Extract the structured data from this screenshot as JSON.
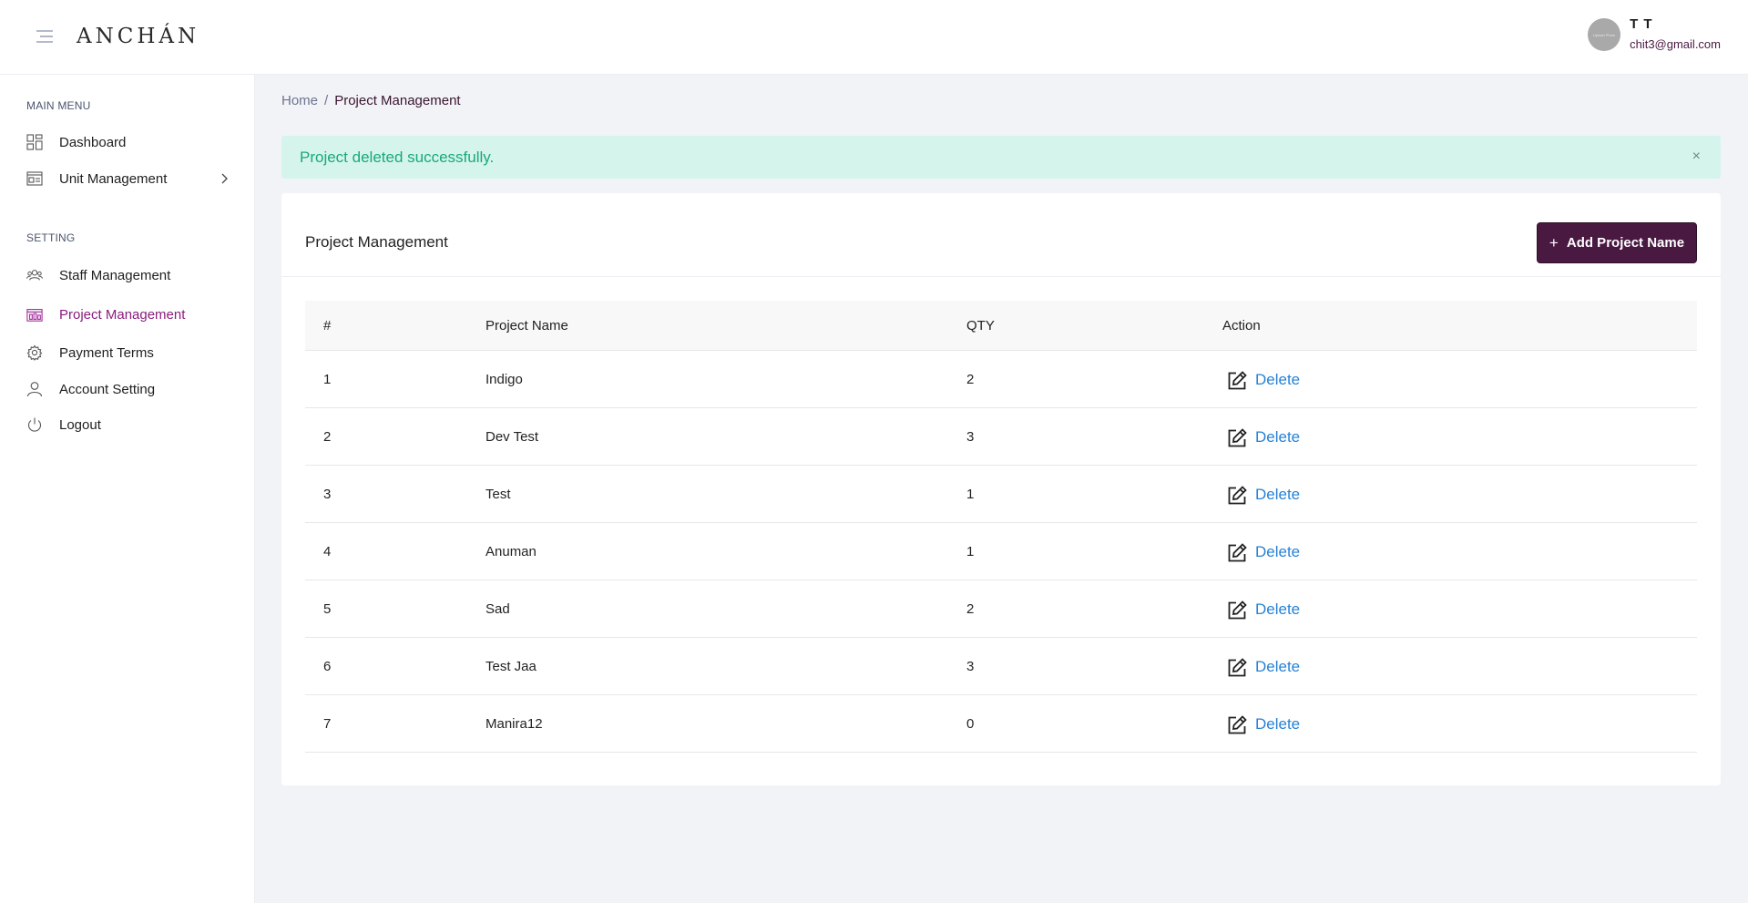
{
  "header": {
    "logo": "ANCHÁN",
    "user": {
      "avatar_text": "Upload Photo",
      "name": "T T",
      "email": "chit3@gmail.com"
    }
  },
  "sidebar": {
    "main_menu_title": "MAIN MENU",
    "main_items": [
      {
        "label": "Dashboard",
        "icon": "dashboard-icon"
      },
      {
        "label": "Unit Management",
        "icon": "unit-icon"
      }
    ],
    "setting_title": "SETTING",
    "setting_items": [
      {
        "label": "Staff Management",
        "icon": "users-icon"
      },
      {
        "label": "Project Management",
        "icon": "project-icon",
        "active": true
      },
      {
        "label": "Payment Terms",
        "icon": "gear-icon"
      },
      {
        "label": "Account Setting",
        "icon": "user-icon"
      },
      {
        "label": "Logout",
        "icon": "power-icon"
      }
    ],
    "active_color": "#8a1d7c"
  },
  "breadcrumb": {
    "home": "Home",
    "separator": "/",
    "current": "Project Management"
  },
  "alert": {
    "message": "Project deleted successfully.",
    "close": "×"
  },
  "card": {
    "title": "Project Management",
    "add_button": "Add Project Name",
    "add_icon": "+"
  },
  "table": {
    "columns": [
      "#",
      "Project Name",
      "QTY",
      "Action"
    ],
    "rows": [
      {
        "no": "1",
        "name": "Indigo",
        "qty": "2",
        "action": "Delete"
      },
      {
        "no": "2",
        "name": "Dev Test",
        "qty": "3",
        "action": "Delete"
      },
      {
        "no": "3",
        "name": "Test",
        "qty": "1",
        "action": "Delete"
      },
      {
        "no": "4",
        "name": "Anuman",
        "qty": "1",
        "action": "Delete"
      },
      {
        "no": "5",
        "name": "Sad",
        "qty": "2",
        "action": "Delete"
      },
      {
        "no": "6",
        "name": "Test Jaa",
        "qty": "3",
        "action": "Delete"
      },
      {
        "no": "7",
        "name": "Manira12",
        "qty": "0",
        "action": "Delete"
      }
    ]
  },
  "colors": {
    "brand": "#4a1942",
    "alert_bg": "#d5f4ec",
    "alert_text": "#19a97a",
    "link": "#2782d5"
  }
}
